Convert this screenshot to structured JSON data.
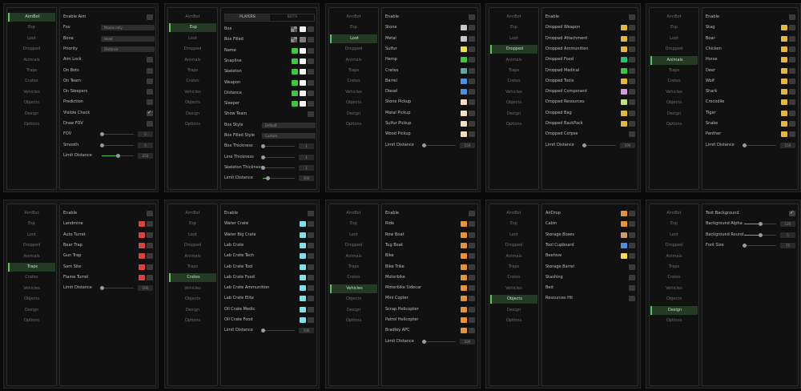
{
  "nav": [
    "AimBot",
    "Esp",
    "Loot",
    "Dropped",
    "Animals",
    "Traps",
    "Crates",
    "Vehicles",
    "Objects",
    "Design",
    "Options"
  ],
  "colors": {
    "green": "#3fc63f",
    "white": "#f2f2f2",
    "silver": "#c8c8c8",
    "gray": "#7d7d7d",
    "teal": "#5ba7a2",
    "blue": "#4a8fde",
    "cream": "#f3dfc1",
    "gold": "#e2b83b",
    "emerald": "#22c376",
    "lightgreen": "#bfe088",
    "pink": "#d69ae3",
    "orange": "#e39436",
    "red": "#d8453c",
    "aqua": "#7fe0ea",
    "tan": "#c9a071",
    "yellow": "#f2df55"
  },
  "panels": [
    {
      "active": 0,
      "rows": [
        {
          "label": "Enable Aim",
          "type": "check",
          "on": false
        },
        {
          "label": "Fov",
          "type": "combo",
          "value": "Mouse only"
        },
        {
          "label": "Bone",
          "type": "combo",
          "value": "Head"
        },
        {
          "label": "Priority",
          "type": "combo",
          "value": "Distance"
        },
        {
          "label": "Aim Lock",
          "type": "check",
          "on": false
        },
        {
          "label": "On Bots",
          "type": "check",
          "on": false
        },
        {
          "label": "On Team",
          "type": "check",
          "on": false
        },
        {
          "label": "On Sleepers",
          "type": "check",
          "on": false
        },
        {
          "label": "Prediction",
          "type": "check",
          "on": false
        },
        {
          "label": "Visible Check",
          "type": "check",
          "on": true
        },
        {
          "label": "Draw FOV",
          "type": "check",
          "on": false
        },
        {
          "label": "FOV",
          "type": "slider",
          "value": "0",
          "level": 0
        },
        {
          "label": "Smooth",
          "type": "slider",
          "value": "0",
          "level": 0
        },
        {
          "label": "Limit Distance",
          "type": "slider",
          "value": "250",
          "level": 0.5
        }
      ]
    },
    {
      "active": 1,
      "tabs": [
        "PLAYERS",
        "BOTS"
      ],
      "rows": [
        {
          "label": "Box",
          "type": "swatch2",
          "c1": "bone",
          "c2": "white"
        },
        {
          "label": "Box Filled",
          "type": "swatch2",
          "c1": "bone",
          "c2": "gray"
        },
        {
          "label": "Name",
          "type": "swatch2",
          "c1": "green",
          "c2": "white"
        },
        {
          "label": "Snapline",
          "type": "swatch2",
          "c1": "green",
          "c2": "white"
        },
        {
          "label": "Skeleton",
          "type": "swatch2",
          "c1": "green",
          "c2": "white"
        },
        {
          "label": "Weapon",
          "type": "swatch2",
          "c1": "green",
          "c2": "white"
        },
        {
          "label": "Distance",
          "type": "swatch2",
          "c1": "green",
          "c2": "white"
        },
        {
          "label": "Sleeper",
          "type": "swatch2",
          "c1": "green",
          "c2": "white"
        },
        {
          "label": "Show Team",
          "type": "check",
          "on": false
        },
        {
          "label": "Box Style",
          "type": "combo",
          "value": "Default"
        },
        {
          "label": "Box Filled Style",
          "type": "combo",
          "value": "Custom"
        },
        {
          "label": "Box Thickness",
          "type": "slider",
          "value": "1",
          "level": 0
        },
        {
          "label": "Line Thickness",
          "type": "slider",
          "value": "1",
          "level": 0
        },
        {
          "label": "Skeleton Thickness",
          "type": "slider",
          "value": "1",
          "level": 0
        },
        {
          "label": "Limit Distance",
          "type": "slider",
          "value": "300",
          "level": 0.15
        }
      ]
    },
    {
      "active": 2,
      "rows": [
        {
          "label": "Enable",
          "type": "check",
          "on": false
        },
        {
          "label": "Stone",
          "type": "swatch",
          "c": "silver"
        },
        {
          "label": "Metal",
          "type": "swatch",
          "c": "silver"
        },
        {
          "label": "Sulfur",
          "type": "swatch",
          "c": "yellow"
        },
        {
          "label": "Hemp",
          "type": "swatch",
          "c": "green"
        },
        {
          "label": "Crates",
          "type": "swatch",
          "c": "teal"
        },
        {
          "label": "Barrel",
          "type": "swatch",
          "c": "blue"
        },
        {
          "label": "Diesel",
          "type": "swatch",
          "c": "blue"
        },
        {
          "label": "Stone Pickup",
          "type": "swatch",
          "c": "cream"
        },
        {
          "label": "Metal Pickup",
          "type": "swatch",
          "c": "cream"
        },
        {
          "label": "Sulfur Pickup",
          "type": "swatch",
          "c": "cream"
        },
        {
          "label": "Wood Pickup",
          "type": "swatch",
          "c": "cream"
        },
        {
          "label": "Limit Distance",
          "type": "slider",
          "value": "150",
          "level": 0
        }
      ]
    },
    {
      "active": 3,
      "rows": [
        {
          "label": "Enable",
          "type": "check",
          "on": false
        },
        {
          "label": "Dropped Weapon",
          "type": "swatch",
          "c": "gold"
        },
        {
          "label": "Dropped Attachment",
          "type": "swatch",
          "c": "gold"
        },
        {
          "label": "Dropped Ammunition",
          "type": "swatch",
          "c": "gold"
        },
        {
          "label": "Dropped Food",
          "type": "swatch",
          "c": "emerald"
        },
        {
          "label": "Dropped Medical",
          "type": "swatch",
          "c": "green"
        },
        {
          "label": "Dropped Tools",
          "type": "swatch",
          "c": "gold"
        },
        {
          "label": "Dropped Component",
          "type": "swatch",
          "c": "pink"
        },
        {
          "label": "Dropped Resources",
          "type": "swatch",
          "c": "lightgreen"
        },
        {
          "label": "Dropped Bag",
          "type": "swatch",
          "c": "gold"
        },
        {
          "label": "Dropped BackPack",
          "type": "swatch",
          "c": "gold"
        },
        {
          "label": "Dropped Corpse",
          "type": "check",
          "on": false
        },
        {
          "label": "Limit Distance",
          "type": "slider",
          "value": "100",
          "level": 0
        }
      ]
    },
    {
      "active": 4,
      "rows": [
        {
          "label": "Enable",
          "type": "check",
          "on": false
        },
        {
          "label": "Stag",
          "type": "swatch",
          "c": "gold"
        },
        {
          "label": "Boar",
          "type": "swatch",
          "c": "gold"
        },
        {
          "label": "Chicken",
          "type": "swatch",
          "c": "gold"
        },
        {
          "label": "Horse",
          "type": "swatch",
          "c": "gold"
        },
        {
          "label": "Deer",
          "type": "swatch",
          "c": "gold"
        },
        {
          "label": "Wolf",
          "type": "swatch",
          "c": "gold"
        },
        {
          "label": "Shark",
          "type": "swatch",
          "c": "gold"
        },
        {
          "label": "Crocodile",
          "type": "swatch",
          "c": "gold"
        },
        {
          "label": "Tiger",
          "type": "swatch",
          "c": "gold"
        },
        {
          "label": "Snake",
          "type": "swatch",
          "c": "gold"
        },
        {
          "label": "Panther",
          "type": "swatch",
          "c": "gold"
        },
        {
          "label": "Limit Distance",
          "type": "slider",
          "value": "150",
          "level": 0
        }
      ]
    },
    {
      "active": 5,
      "rows": [
        {
          "label": "Enable",
          "type": "check",
          "on": false
        },
        {
          "label": "Landmine",
          "type": "swatch",
          "c": "red"
        },
        {
          "label": "Auto Turret",
          "type": "swatch",
          "c": "red"
        },
        {
          "label": "Bear Trap",
          "type": "swatch",
          "c": "red"
        },
        {
          "label": "Gun Trap",
          "type": "swatch",
          "c": "red"
        },
        {
          "label": "Sam Site",
          "type": "swatch",
          "c": "red"
        },
        {
          "label": "Flame Turret",
          "type": "swatch",
          "c": "red"
        },
        {
          "label": "Limit Distance",
          "type": "slider",
          "value": "100",
          "level": 0
        }
      ]
    },
    {
      "active": 6,
      "rows": [
        {
          "label": "Enable",
          "type": "check",
          "on": false
        },
        {
          "label": "Water Crate",
          "type": "swatch",
          "c": "aqua"
        },
        {
          "label": "Water Big Crate",
          "type": "swatch",
          "c": "aqua"
        },
        {
          "label": "Lab Crate",
          "type": "swatch",
          "c": "aqua"
        },
        {
          "label": "Lab Crate Tech",
          "type": "swatch",
          "c": "aqua"
        },
        {
          "label": "Lab Crate Tool",
          "type": "swatch",
          "c": "aqua"
        },
        {
          "label": "Lab Crate Food",
          "type": "swatch",
          "c": "aqua"
        },
        {
          "label": "Lab Crate Ammunition",
          "type": "swatch",
          "c": "aqua"
        },
        {
          "label": "Lab Crate Elite",
          "type": "swatch",
          "c": "aqua"
        },
        {
          "label": "Oil Crate Medic",
          "type": "swatch",
          "c": "aqua"
        },
        {
          "label": "Oil Crate Food",
          "type": "swatch",
          "c": "aqua"
        },
        {
          "label": "Limit Distance",
          "type": "slider",
          "value": "100",
          "level": 0
        }
      ]
    },
    {
      "active": 7,
      "rows": [
        {
          "label": "Enable",
          "type": "check",
          "on": false
        },
        {
          "label": "Ride",
          "type": "swatch",
          "c": "orange"
        },
        {
          "label": "Row Boat",
          "type": "swatch",
          "c": "orange"
        },
        {
          "label": "Tug Boat",
          "type": "swatch",
          "c": "orange"
        },
        {
          "label": "Bike",
          "type": "swatch",
          "c": "orange"
        },
        {
          "label": "Bike Trike",
          "type": "swatch",
          "c": "orange"
        },
        {
          "label": "Motorbike",
          "type": "swatch",
          "c": "orange"
        },
        {
          "label": "Motorbike Sidecar",
          "type": "swatch",
          "c": "orange"
        },
        {
          "label": "Mini Copter",
          "type": "swatch",
          "c": "orange"
        },
        {
          "label": "Scrap Helicopter",
          "type": "swatch",
          "c": "orange"
        },
        {
          "label": "Patrol Helicopter",
          "type": "swatch",
          "c": "orange"
        },
        {
          "label": "Bradley APC",
          "type": "swatch",
          "c": "orange"
        },
        {
          "label": "Limit Distance",
          "type": "slider",
          "value": "100",
          "level": 0
        }
      ]
    },
    {
      "active": 8,
      "rows": [
        {
          "label": "AirDrop",
          "type": "swatch",
          "c": "orange"
        },
        {
          "label": "Cabin",
          "type": "swatch",
          "c": "orange"
        },
        {
          "label": "Storage Boxes",
          "type": "swatch",
          "c": "tan"
        },
        {
          "label": "Tool Cupboard",
          "type": "swatch",
          "c": "blue"
        },
        {
          "label": "Beehive",
          "type": "swatch",
          "c": "yellow"
        },
        {
          "label": "Storage Barrel",
          "type": "check",
          "on": false
        },
        {
          "label": "Stashing",
          "type": "check",
          "on": false
        },
        {
          "label": "Bed",
          "type": "check",
          "on": false
        },
        {
          "label": "Resources Hit",
          "type": "check",
          "on": false
        }
      ]
    },
    {
      "active": 9,
      "rows": [
        {
          "label": "Text Background",
          "type": "check",
          "on": true
        },
        {
          "label": "Background Alpha",
          "type": "slider",
          "value": "120",
          "level": 0.5
        },
        {
          "label": "Background Round",
          "type": "slider",
          "value": "5",
          "level": 0.5
        },
        {
          "label": "Font Size",
          "type": "slider",
          "value": "75",
          "level": 0
        }
      ]
    }
  ]
}
